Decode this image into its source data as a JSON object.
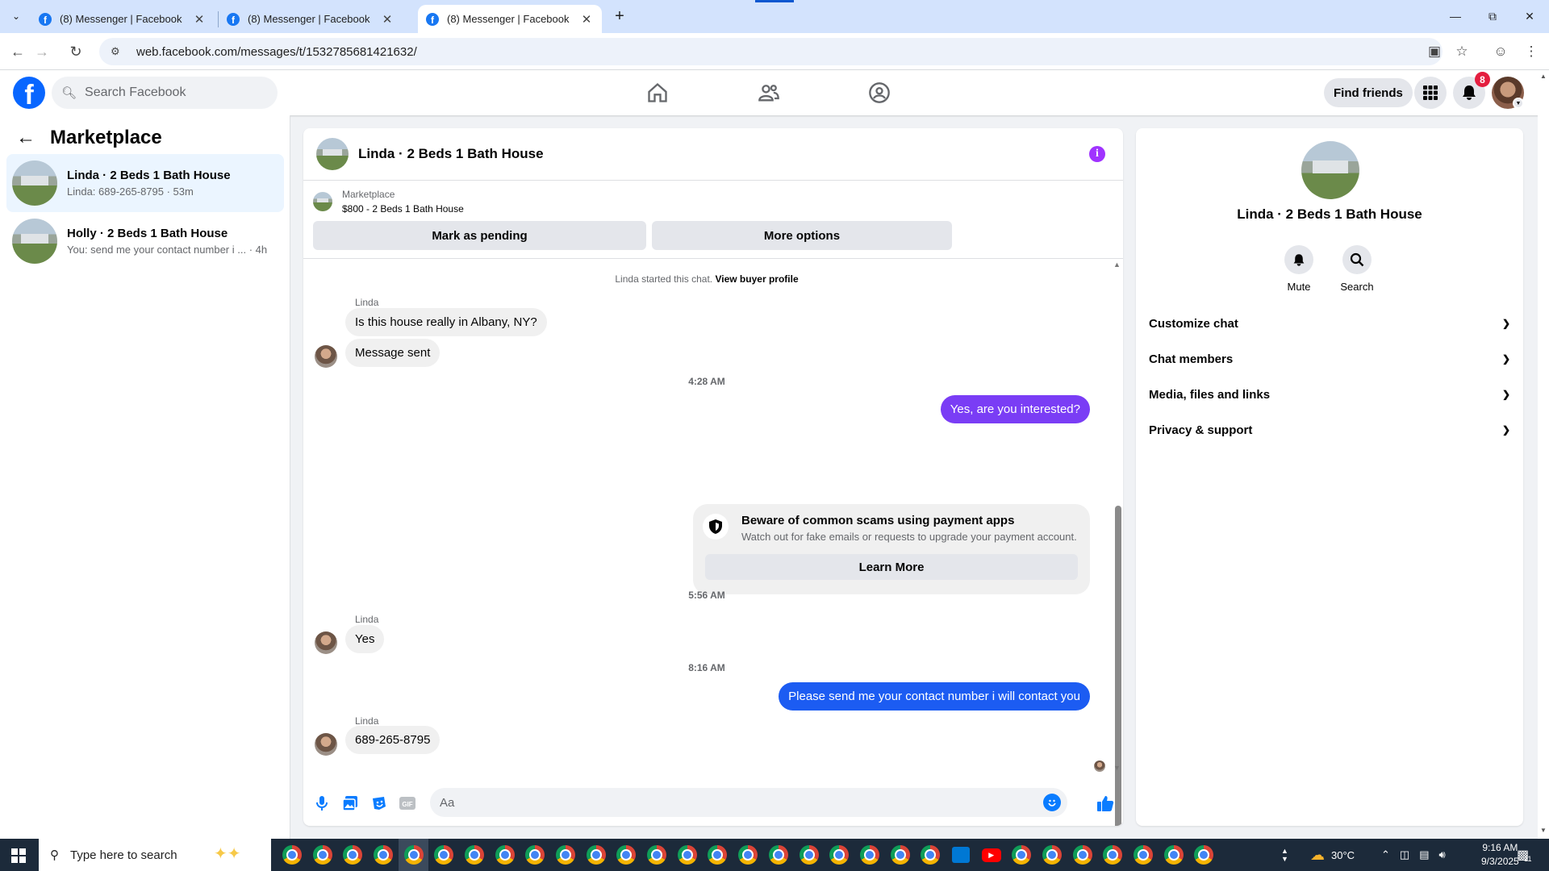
{
  "browser": {
    "tabs": [
      {
        "title": "(8) Messenger | Facebook",
        "active": false
      },
      {
        "title": "(8) Messenger | Facebook",
        "active": false
      },
      {
        "title": "(8) Messenger | Facebook",
        "active": true
      }
    ],
    "url": "web.facebook.com/messages/t/1532785681421632/"
  },
  "fb_header": {
    "search_placeholder": "Search Facebook",
    "find_friends_label": "Find friends",
    "notification_count": "8"
  },
  "sidebar": {
    "title": "Marketplace",
    "conversations": [
      {
        "name": "Linda · 2 Beds 1 Bath House",
        "preview": "Linda: 689-265-8795 · 53m",
        "active": true
      },
      {
        "name": "Holly · 2 Beds 1 Bath House",
        "preview": "You: send me your contact number i ... · 4h",
        "active": false
      }
    ]
  },
  "chat": {
    "title": "Linda · 2 Beds 1 Bath House",
    "listing": {
      "label": "Marketplace",
      "detail": "$800 - 2 Beds 1 Bath House"
    },
    "buttons": {
      "mark_pending": "Mark as pending",
      "more_options": "More options"
    },
    "started_text": "Linda started this chat.",
    "view_profile": "View buyer profile",
    "messages": [
      {
        "sender": "Linda",
        "text": "Is this house really in Albany, NY?"
      },
      {
        "text": "Message sent"
      },
      {
        "timestamp": "4:28 AM"
      },
      {
        "text": "Yes, are you interested?",
        "outgoing": true
      },
      {
        "timestamp": "5:56 AM"
      },
      {
        "sender": "Linda",
        "text": "Yes"
      },
      {
        "timestamp": "8:16 AM"
      },
      {
        "text": "Please send me your contact number i will contact you",
        "outgoing": true
      },
      {
        "sender": "Linda",
        "text": "689-265-8795"
      }
    ],
    "scam_notice": {
      "title": "Beware of common scams using payment apps",
      "body": "Watch out for fake emails or requests to upgrade your payment account.",
      "button": "Learn More"
    },
    "composer_placeholder": "Aa"
  },
  "info_panel": {
    "name": "Linda · 2 Beds 1 Bath House",
    "actions": {
      "mute": "Mute",
      "search": "Search"
    },
    "sections": [
      "Customize chat",
      "Chat members",
      "Media, files and links",
      "Privacy & support"
    ]
  },
  "taskbar": {
    "search_placeholder": "Type here to search",
    "temperature": "30°C",
    "time": "9:16 AM",
    "date": "9/3/2025",
    "notification_count": "11"
  },
  "colors": {
    "fb_blue": "#0866ff",
    "outgoing_purple": "#7a3df5",
    "outgoing_blue": "#1c5cf2",
    "info_purple": "#a033ff"
  }
}
